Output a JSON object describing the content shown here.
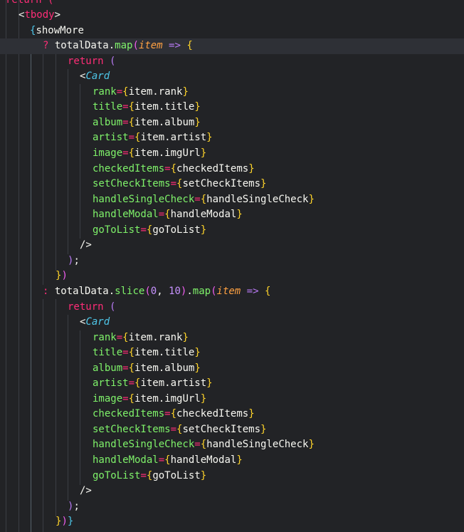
{
  "editor": {
    "lines": [
      [
        {
          "t": "return (",
          "c": "t-kw"
        }
      ],
      [
        {
          "t": "<",
          "c": "t-punct"
        },
        {
          "t": "tbody",
          "c": "t-tag"
        },
        {
          "t": ">",
          "c": "t-punct"
        }
      ],
      [
        {
          "t": "{",
          "c": "t-cyan"
        },
        {
          "t": "showMore",
          "c": "t-plain"
        }
      ],
      [
        {
          "t": "? ",
          "c": "t-kw"
        },
        {
          "t": "totalData",
          "c": "t-plain"
        },
        {
          "t": ".",
          "c": "t-punct"
        },
        {
          "t": "map",
          "c": "t-fn"
        },
        {
          "t": "(",
          "c": "t-paren"
        },
        {
          "t": "item",
          "c": "t-param"
        },
        {
          "t": " => ",
          "c": "t-arrow"
        },
        {
          "t": "{",
          "c": "t-brace"
        }
      ],
      [
        {
          "t": "return ",
          "c": "t-kw"
        },
        {
          "t": "(",
          "c": "t-arrow"
        }
      ],
      [
        {
          "t": "<",
          "c": "t-punct"
        },
        {
          "t": "Card",
          "c": "t-comp"
        }
      ],
      [
        {
          "t": "rank",
          "c": "t-attr"
        },
        {
          "t": "=",
          "c": "t-kw"
        },
        {
          "t": "{",
          "c": "t-brace"
        },
        {
          "t": "item.rank",
          "c": "t-plain"
        },
        {
          "t": "}",
          "c": "t-brace"
        }
      ],
      [
        {
          "t": "title",
          "c": "t-attr"
        },
        {
          "t": "=",
          "c": "t-kw"
        },
        {
          "t": "{",
          "c": "t-brace"
        },
        {
          "t": "item.title",
          "c": "t-plain"
        },
        {
          "t": "}",
          "c": "t-brace"
        }
      ],
      [
        {
          "t": "album",
          "c": "t-attr"
        },
        {
          "t": "=",
          "c": "t-kw"
        },
        {
          "t": "{",
          "c": "t-brace"
        },
        {
          "t": "item.album",
          "c": "t-plain"
        },
        {
          "t": "}",
          "c": "t-brace"
        }
      ],
      [
        {
          "t": "artist",
          "c": "t-attr"
        },
        {
          "t": "=",
          "c": "t-kw"
        },
        {
          "t": "{",
          "c": "t-brace"
        },
        {
          "t": "item.artist",
          "c": "t-plain"
        },
        {
          "t": "}",
          "c": "t-brace"
        }
      ],
      [
        {
          "t": "image",
          "c": "t-attr"
        },
        {
          "t": "=",
          "c": "t-kw"
        },
        {
          "t": "{",
          "c": "t-brace"
        },
        {
          "t": "item.imgUrl",
          "c": "t-plain"
        },
        {
          "t": "}",
          "c": "t-brace"
        }
      ],
      [
        {
          "t": "checkedItems",
          "c": "t-attr"
        },
        {
          "t": "=",
          "c": "t-kw"
        },
        {
          "t": "{",
          "c": "t-brace"
        },
        {
          "t": "checkedItems",
          "c": "t-plain"
        },
        {
          "t": "}",
          "c": "t-brace"
        }
      ],
      [
        {
          "t": "setCheckItems",
          "c": "t-attr"
        },
        {
          "t": "=",
          "c": "t-kw"
        },
        {
          "t": "{",
          "c": "t-brace"
        },
        {
          "t": "setCheckItems",
          "c": "t-plain"
        },
        {
          "t": "}",
          "c": "t-brace"
        }
      ],
      [
        {
          "t": "handleSingleCheck",
          "c": "t-attr"
        },
        {
          "t": "=",
          "c": "t-kw"
        },
        {
          "t": "{",
          "c": "t-brace"
        },
        {
          "t": "handleSingleCheck",
          "c": "t-plain"
        },
        {
          "t": "}",
          "c": "t-brace"
        }
      ],
      [
        {
          "t": "handleModal",
          "c": "t-attr"
        },
        {
          "t": "=",
          "c": "t-kw"
        },
        {
          "t": "{",
          "c": "t-brace"
        },
        {
          "t": "handleModal",
          "c": "t-plain"
        },
        {
          "t": "}",
          "c": "t-brace"
        }
      ],
      [
        {
          "t": "goToList",
          "c": "t-attr"
        },
        {
          "t": "=",
          "c": "t-kw"
        },
        {
          "t": "{",
          "c": "t-brace"
        },
        {
          "t": "goToList",
          "c": "t-plain"
        },
        {
          "t": "}",
          "c": "t-brace"
        }
      ],
      [
        {
          "t": "/>",
          "c": "t-punct"
        }
      ],
      [
        {
          "t": ")",
          "c": "t-arrow"
        },
        {
          "t": ";",
          "c": "t-punct"
        }
      ],
      [
        {
          "t": "}",
          "c": "t-brace"
        },
        {
          "t": ")",
          "c": "t-paren"
        }
      ],
      [
        {
          "t": ": ",
          "c": "t-kw"
        },
        {
          "t": "totalData",
          "c": "t-plain"
        },
        {
          "t": ".",
          "c": "t-punct"
        },
        {
          "t": "slice",
          "c": "t-fn"
        },
        {
          "t": "(",
          "c": "t-paren"
        },
        {
          "t": "0",
          "c": "t-num"
        },
        {
          "t": ", ",
          "c": "t-punct"
        },
        {
          "t": "10",
          "c": "t-num"
        },
        {
          "t": ")",
          "c": "t-paren"
        },
        {
          "t": ".",
          "c": "t-punct"
        },
        {
          "t": "map",
          "c": "t-fn"
        },
        {
          "t": "(",
          "c": "t-paren"
        },
        {
          "t": "item",
          "c": "t-param"
        },
        {
          "t": " => ",
          "c": "t-arrow"
        },
        {
          "t": "{",
          "c": "t-brace"
        }
      ],
      [
        {
          "t": "return ",
          "c": "t-kw"
        },
        {
          "t": "(",
          "c": "t-arrow"
        }
      ],
      [
        {
          "t": "<",
          "c": "t-punct"
        },
        {
          "t": "Card",
          "c": "t-comp"
        }
      ],
      [
        {
          "t": "rank",
          "c": "t-attr"
        },
        {
          "t": "=",
          "c": "t-kw"
        },
        {
          "t": "{",
          "c": "t-brace"
        },
        {
          "t": "item.rank",
          "c": "t-plain"
        },
        {
          "t": "}",
          "c": "t-brace"
        }
      ],
      [
        {
          "t": "title",
          "c": "t-attr"
        },
        {
          "t": "=",
          "c": "t-kw"
        },
        {
          "t": "{",
          "c": "t-brace"
        },
        {
          "t": "item.title",
          "c": "t-plain"
        },
        {
          "t": "}",
          "c": "t-brace"
        }
      ],
      [
        {
          "t": "album",
          "c": "t-attr"
        },
        {
          "t": "=",
          "c": "t-kw"
        },
        {
          "t": "{",
          "c": "t-brace"
        },
        {
          "t": "item.album",
          "c": "t-plain"
        },
        {
          "t": "}",
          "c": "t-brace"
        }
      ],
      [
        {
          "t": "artist",
          "c": "t-attr"
        },
        {
          "t": "=",
          "c": "t-kw"
        },
        {
          "t": "{",
          "c": "t-brace"
        },
        {
          "t": "item.artist",
          "c": "t-plain"
        },
        {
          "t": "}",
          "c": "t-brace"
        }
      ],
      [
        {
          "t": "image",
          "c": "t-attr"
        },
        {
          "t": "=",
          "c": "t-kw"
        },
        {
          "t": "{",
          "c": "t-brace"
        },
        {
          "t": "item.imgUrl",
          "c": "t-plain"
        },
        {
          "t": "}",
          "c": "t-brace"
        }
      ],
      [
        {
          "t": "checkedItems",
          "c": "t-attr"
        },
        {
          "t": "=",
          "c": "t-kw"
        },
        {
          "t": "{",
          "c": "t-brace"
        },
        {
          "t": "checkedItems",
          "c": "t-plain"
        },
        {
          "t": "}",
          "c": "t-brace"
        }
      ],
      [
        {
          "t": "setCheckItems",
          "c": "t-attr"
        },
        {
          "t": "=",
          "c": "t-kw"
        },
        {
          "t": "{",
          "c": "t-brace"
        },
        {
          "t": "setCheckItems",
          "c": "t-plain"
        },
        {
          "t": "}",
          "c": "t-brace"
        }
      ],
      [
        {
          "t": "handleSingleCheck",
          "c": "t-attr"
        },
        {
          "t": "=",
          "c": "t-kw"
        },
        {
          "t": "{",
          "c": "t-brace"
        },
        {
          "t": "handleSingleCheck",
          "c": "t-plain"
        },
        {
          "t": "}",
          "c": "t-brace"
        }
      ],
      [
        {
          "t": "handleModal",
          "c": "t-attr"
        },
        {
          "t": "=",
          "c": "t-kw"
        },
        {
          "t": "{",
          "c": "t-brace"
        },
        {
          "t": "handleModal",
          "c": "t-plain"
        },
        {
          "t": "}",
          "c": "t-brace"
        }
      ],
      [
        {
          "t": "goToList",
          "c": "t-attr"
        },
        {
          "t": "=",
          "c": "t-kw"
        },
        {
          "t": "{",
          "c": "t-brace"
        },
        {
          "t": "goToList",
          "c": "t-plain"
        },
        {
          "t": "}",
          "c": "t-brace"
        }
      ],
      [
        {
          "t": "/>",
          "c": "t-punct"
        }
      ],
      [
        {
          "t": ")",
          "c": "t-arrow"
        },
        {
          "t": ";",
          "c": "t-punct"
        }
      ],
      [
        {
          "t": "}",
          "c": "t-brace"
        },
        {
          "t": ")",
          "c": "t-paren"
        },
        {
          "t": "}",
          "c": "t-cyan"
        }
      ]
    ]
  }
}
